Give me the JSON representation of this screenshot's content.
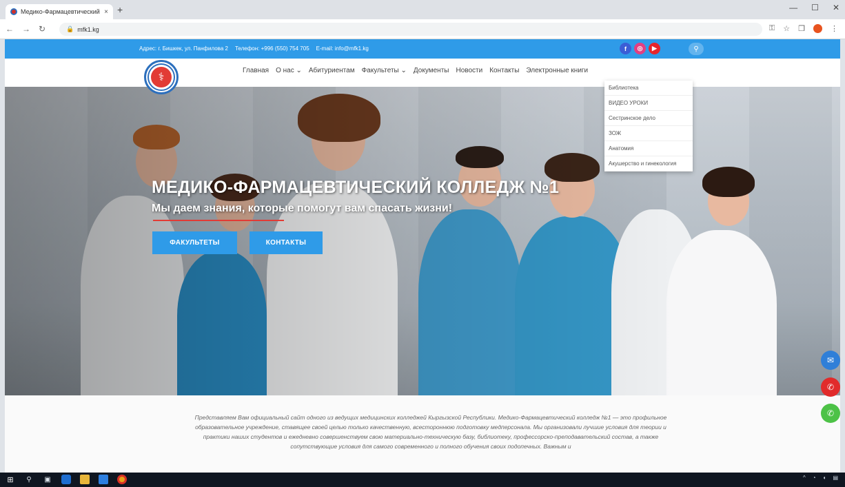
{
  "browser": {
    "tab_title": "Медико-Фармацевтический к...",
    "tab_close": "×",
    "new_tab": "+",
    "window_controls": [
      "—",
      "☐",
      "✕"
    ],
    "url": "mfk1.kg"
  },
  "infobar": {
    "address": "Адрес: г. Бишкек, ул. Панфилова 2",
    "phone": "Телефон: +996 (550) 754 705",
    "email": "E-mail: info@mfk1.kg",
    "socials": [
      "facebook-icon",
      "instagram-icon",
      "youtube-icon"
    ]
  },
  "nav": {
    "items": [
      "Главная",
      "О нас",
      "Абитуриентам",
      "Факультеты",
      "Документы",
      "Новости",
      "Контакты",
      "Электронные книги"
    ],
    "dropdown": [
      "Библиотека",
      "ВИДЕО УРОКИ",
      "Сестринское дело",
      "ЗОЖ",
      "Анатомия",
      "Акушерство и гинекология"
    ]
  },
  "hero": {
    "title": "МЕДИКО-ФАРМАЦЕВТИЧЕСКИЙ КОЛЛЕДЖ №1",
    "subtitle": "Мы даем знания, которые помогут вам спасать жизни!",
    "btn_faculties": "ФАКУЛЬТЕТЫ",
    "btn_contacts": "КОНТАКТЫ"
  },
  "intro": {
    "text": "Представляем Вам официальный сайт одного из ведущих медицинских колледжей Кыргызской Республики. Медико-Фармацевтический колледж №1 — это профильное образовательное учреждение, ставящее своей целью только качественную, всестороннюю подготовку медперсонала. Мы организовали лучшие условия для теории и практики наших студентов и ежедневно совершенствуем свою материально-техническую базу, библиотеку, профессорско-преподавательский состав, а также сопутствующие условия для самого современного и полного обучения своих подопечных. Важным и"
  },
  "colors": {
    "accent": "#2f9be8",
    "brand_red": "#e23b35"
  }
}
